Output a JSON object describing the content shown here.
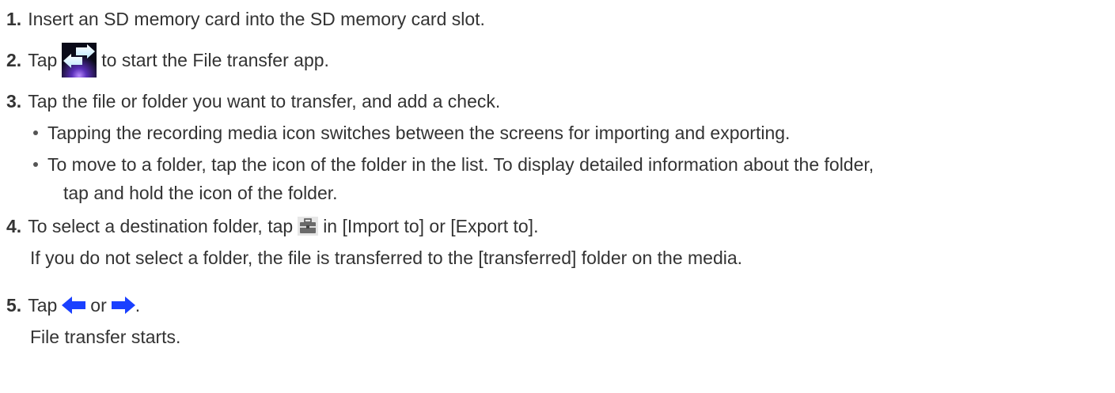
{
  "steps": [
    {
      "num": "1.",
      "text": "Insert an SD memory card into the SD memory card slot."
    },
    {
      "num": "2.",
      "before": "Tap",
      "after": "to start the File transfer app.",
      "icon": "file-transfer-app-icon"
    },
    {
      "num": "3.",
      "text": "Tap the file or folder you want to transfer, and add a check.",
      "bullets": [
        {
          "lines": [
            "Tapping the recording media icon switches between the screens for importing and exporting."
          ]
        },
        {
          "lines": [
            "To move to a folder, tap the icon of the folder in the list. To display detailed information about the folder,",
            "tap and hold the icon of the folder."
          ]
        }
      ]
    },
    {
      "num": "4.",
      "before": "To select a destination folder, tap",
      "after": "in [Import to] or [Export to].",
      "icon": "toolbox-icon",
      "note": "If you do not select a folder, the file is transferred to the [transferred] folder on the media."
    },
    {
      "num": "5.",
      "before": "Tap",
      "middle": "or",
      "after": ".",
      "icons": [
        "arrow-left-icon",
        "arrow-right-icon"
      ],
      "note": "File transfer starts."
    }
  ],
  "colors": {
    "text": "#333333",
    "arrow_blue": "#1a40ff"
  }
}
